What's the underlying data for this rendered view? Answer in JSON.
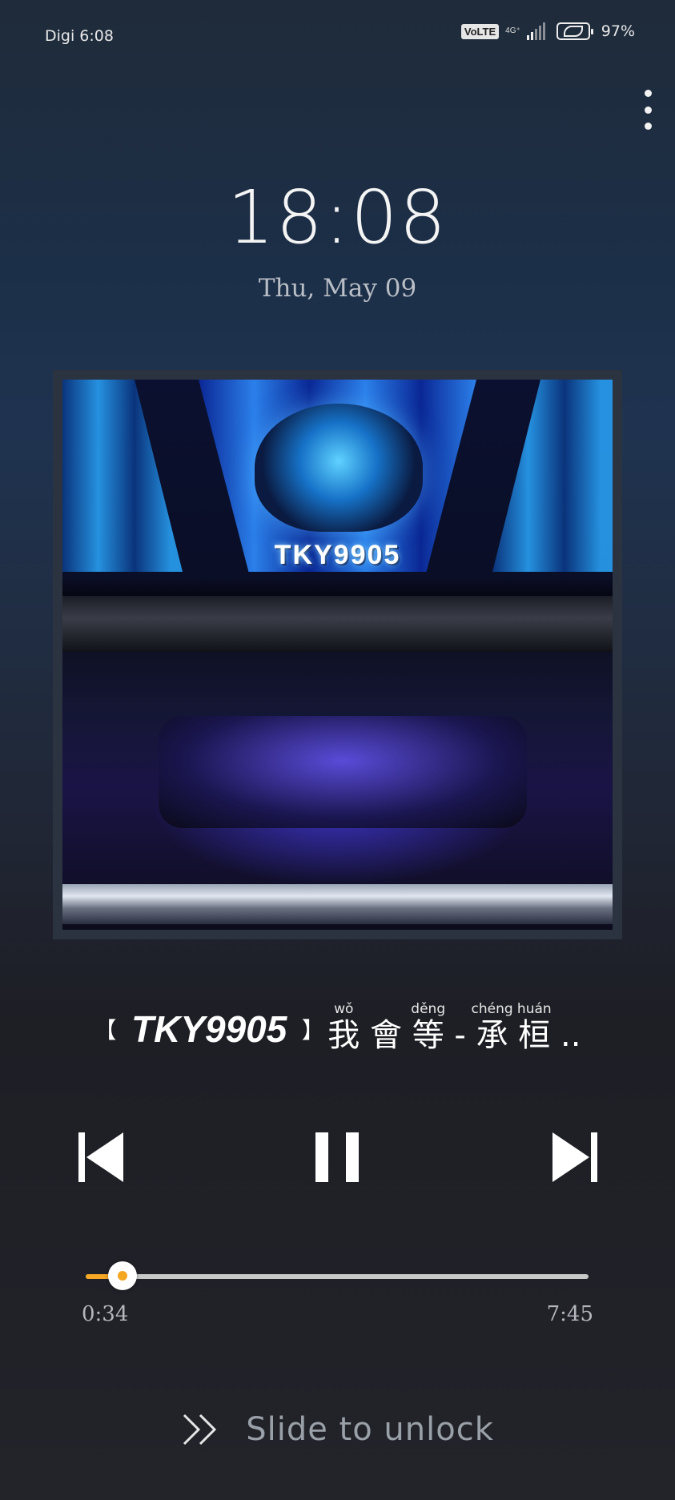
{
  "status_bar": {
    "carrier": "Digi 6:08",
    "volte": "VoLTE",
    "network": "4G⁺",
    "battery_percent": "97%",
    "signal_bars": 4
  },
  "lock_screen": {
    "time": "18:08",
    "date": "Thu, May 09"
  },
  "media": {
    "title_bracket_open": "【",
    "title_main": "TKY9905",
    "title_bracket_close": "】",
    "title_cjk": [
      {
        "char": "我",
        "pinyin": "wǒ"
      },
      {
        "char": "會",
        "pinyin": ""
      },
      {
        "char": "等",
        "pinyin": "děng"
      },
      {
        "char": "-",
        "pinyin": ""
      },
      {
        "char": "承",
        "pinyin": "chéng"
      },
      {
        "char": "桓",
        "pinyin": "huán"
      },
      {
        "char": "..",
        "pinyin": ""
      }
    ],
    "album_art_text": "TKY9905",
    "current_time": "0:34",
    "total_time": "7:45",
    "progress_fraction": 0.073
  },
  "unlock": {
    "label": "Slide to unlock"
  },
  "colors": {
    "progress_played": "#f5a623",
    "progress_track": "#c8c8c8",
    "background_top": "#1f2b3a",
    "background_bottom": "#22242a"
  }
}
